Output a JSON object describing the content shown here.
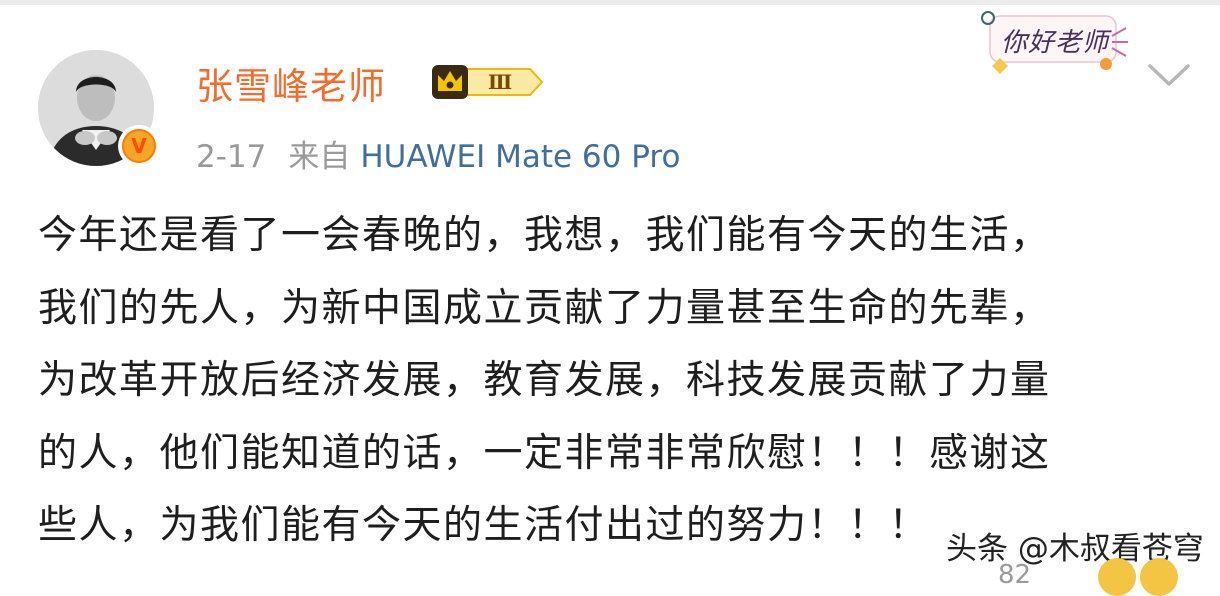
{
  "post": {
    "author": "张雪峰老师",
    "level_badge": "Ⅲ",
    "date": "2-17",
    "source_prefix": "来自",
    "device": "HUAWEI Mate 60 Pro",
    "verified_mark": "V",
    "lines": [
      "今年还是看了一会春晚的，我想，我们能有今天的生活，",
      "我们的先人，为新中国成立贡献了力量甚至生命的先辈，",
      "为改革开放后经济发展，教育发展，科技发展贡献了力量",
      "的人，他们能知道的话，一定非常非常欣慰！！！感谢这",
      "些人，为我们能有今天的生活付出过的努力！！！"
    ]
  },
  "sticker": {
    "text": "你好老师"
  },
  "watermark": "头条 @木叔看苍穹",
  "footer": {
    "count": "82"
  },
  "colors": {
    "author": "#f46c2c",
    "device": "#3f6f9e",
    "meta": "#9a9a9a",
    "body_text": "#1e1e1e",
    "vip_badge": "#f5b400"
  },
  "icons": [
    "avatar",
    "verified-badge-icon",
    "crown-level-icon",
    "sticker-decoration",
    "chevron-down-icon",
    "emoji-icon"
  ]
}
